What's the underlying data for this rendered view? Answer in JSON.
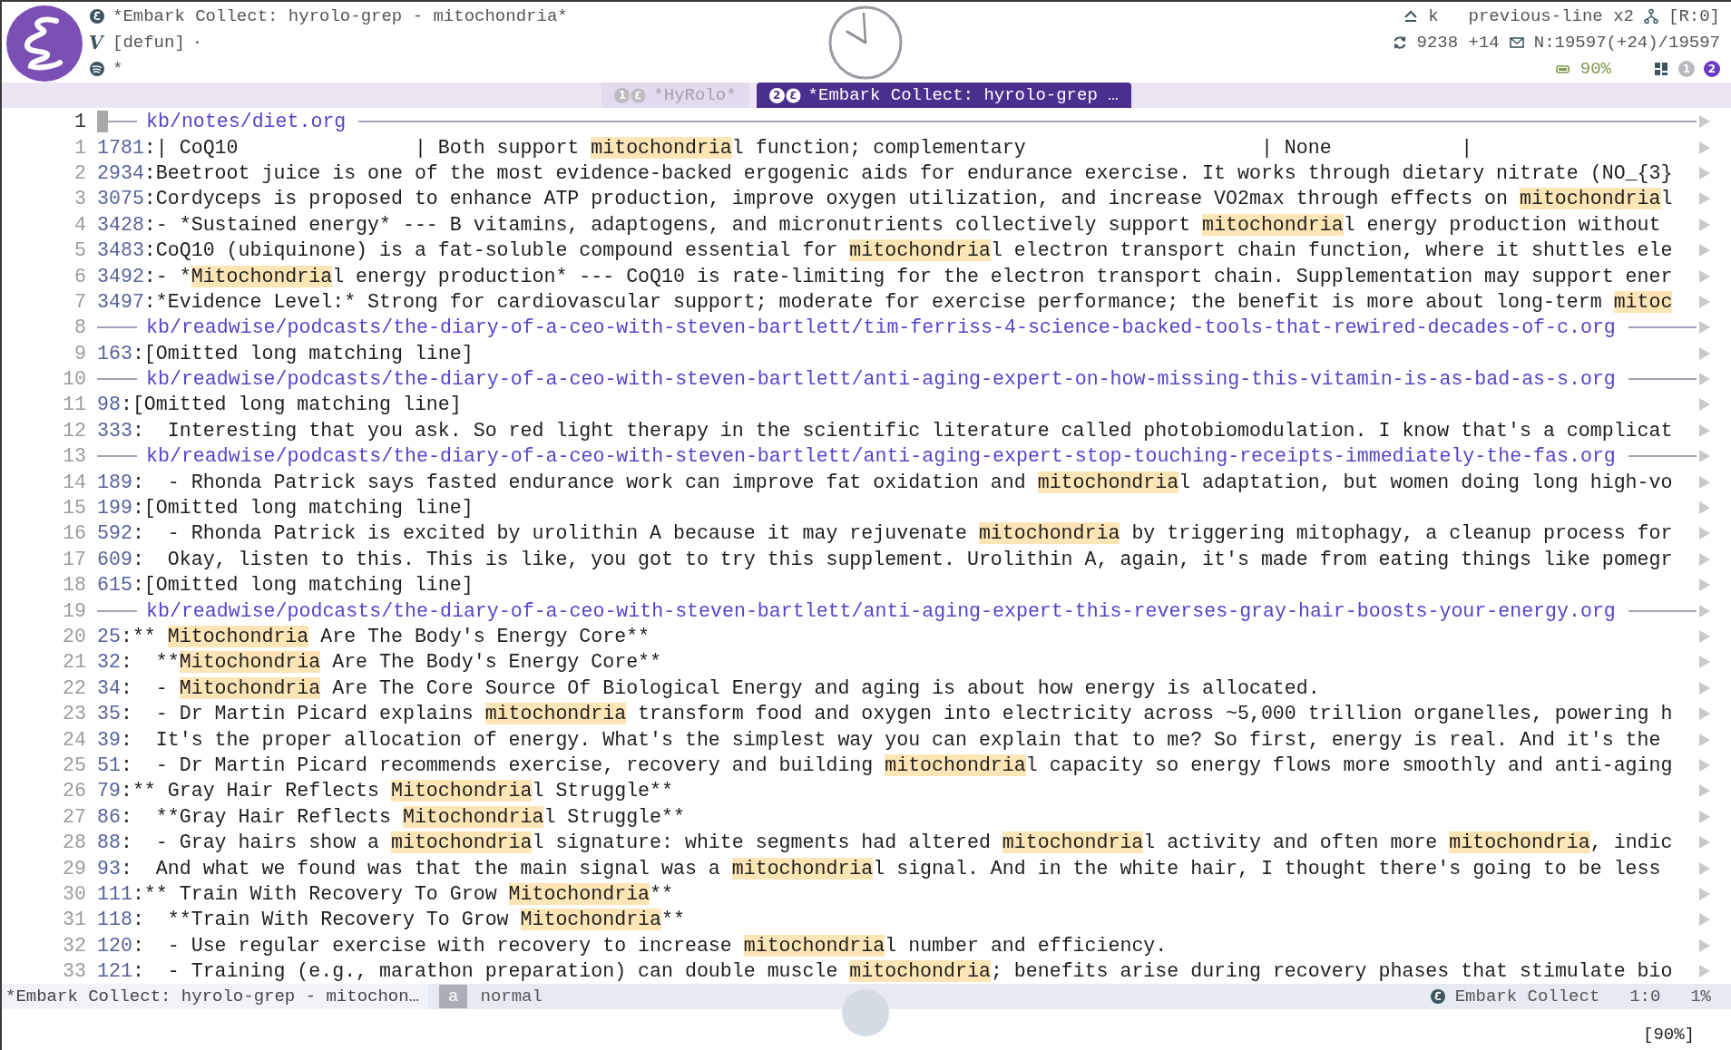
{
  "header": {
    "title": "*Embark Collect: hyrolo-grep - mitochondria*",
    "mode_glyph": "V",
    "function": "[defun]",
    "dot": "·",
    "marker": "*",
    "key": "k",
    "command": "previous-line x2",
    "register": "[R:0]",
    "sync": "9238 +14",
    "mail": "N:19597(+24)/19597",
    "battery": "90%",
    "workspaces": [
      {
        "label": "1",
        "selected": false
      },
      {
        "label": "2",
        "selected": true
      }
    ]
  },
  "tabs": [
    {
      "number": "1",
      "label": "*HyRolo*",
      "selected": false
    },
    {
      "number": "2",
      "label": "*Embark Collect: hyrolo-grep …",
      "selected": true
    }
  ],
  "rows": [
    {
      "line_number": "1",
      "kind": "file",
      "cursor": true,
      "path": "kb/notes/diet.org"
    },
    {
      "line_number": "1",
      "kind": "match",
      "cursor": false,
      "ref": "1781",
      "segments": [
        {
          "text": ":| CoQ10               | Both support ",
          "highlight": false
        },
        {
          "text": "mitochondria",
          "highlight": true
        },
        {
          "text": "l function; complementary                    | None           |",
          "highlight": false
        }
      ]
    },
    {
      "line_number": "2",
      "kind": "match",
      "cursor": false,
      "ref": "2934",
      "segments": [
        {
          "text": ":Beetroot juice is one of the most evidence-backed ergogenic aids for endurance exercise. It works through dietary nitrate (NO_{3}",
          "highlight": false
        }
      ]
    },
    {
      "line_number": "3",
      "kind": "match",
      "cursor": false,
      "ref": "3075",
      "segments": [
        {
          "text": ":Cordyceps is proposed to enhance ATP production, improve oxygen utilization, and increase VO2max through effects on ",
          "highlight": false
        },
        {
          "text": "mitochondria",
          "highlight": true
        },
        {
          "text": "l",
          "highlight": false
        }
      ]
    },
    {
      "line_number": "4",
      "kind": "match",
      "cursor": false,
      "ref": "3428",
      "segments": [
        {
          "text": ":- *Sustained energy* --- B vitamins, adaptogens, and micronutrients collectively support ",
          "highlight": false
        },
        {
          "text": "mitochondria",
          "highlight": true
        },
        {
          "text": "l energy production without",
          "highlight": false
        }
      ]
    },
    {
      "line_number": "5",
      "kind": "match",
      "cursor": false,
      "ref": "3483",
      "segments": [
        {
          "text": ":CoQ10 (ubiquinone) is a fat-soluble compound essential for ",
          "highlight": false
        },
        {
          "text": "mitochondria",
          "highlight": true
        },
        {
          "text": "l electron transport chain function, where it shuttles ele",
          "highlight": false
        }
      ]
    },
    {
      "line_number": "6",
      "kind": "match",
      "cursor": false,
      "ref": "3492",
      "segments": [
        {
          "text": ":- *",
          "highlight": false
        },
        {
          "text": "Mitochondria",
          "highlight": true
        },
        {
          "text": "l energy production* --- CoQ10 is rate-limiting for the electron transport chain. Supplementation may support ener",
          "highlight": false
        }
      ]
    },
    {
      "line_number": "7",
      "kind": "match",
      "cursor": false,
      "ref": "3497",
      "segments": [
        {
          "text": ":*Evidence Level:* Strong for cardiovascular support; moderate for exercise performance; the benefit is more about long-term ",
          "highlight": false
        },
        {
          "text": "mitoc",
          "highlight": true
        }
      ]
    },
    {
      "line_number": "8",
      "kind": "file",
      "cursor": false,
      "path": "kb/readwise/podcasts/the-diary-of-a-ceo-with-steven-bartlett/tim-ferriss-4-science-backed-tools-that-rewired-decades-of-c.org"
    },
    {
      "line_number": "9",
      "kind": "match",
      "cursor": false,
      "ref": "163",
      "segments": [
        {
          "text": ":[Omitted long matching line]",
          "highlight": false
        }
      ]
    },
    {
      "line_number": "10",
      "kind": "file",
      "cursor": false,
      "path": "kb/readwise/podcasts/the-diary-of-a-ceo-with-steven-bartlett/anti-aging-expert-on-how-missing-this-vitamin-is-as-bad-as-s.org"
    },
    {
      "line_number": "11",
      "kind": "match",
      "cursor": false,
      "ref": "98",
      "segments": [
        {
          "text": ":[Omitted long matching line]",
          "highlight": false
        }
      ]
    },
    {
      "line_number": "12",
      "kind": "match",
      "cursor": false,
      "ref": "333",
      "segments": [
        {
          "text": ":  Interesting that you ask. So red light therapy in the scientific literature called photobiomodulation. I know that's a complicat",
          "highlight": false
        }
      ]
    },
    {
      "line_number": "13",
      "kind": "file",
      "cursor": false,
      "path": "kb/readwise/podcasts/the-diary-of-a-ceo-with-steven-bartlett/anti-aging-expert-stop-touching-receipts-immediately-the-fas.org"
    },
    {
      "line_number": "14",
      "kind": "match",
      "cursor": false,
      "ref": "189",
      "segments": [
        {
          "text": ":  - Rhonda Patrick says fasted endurance work can improve fat oxidation and ",
          "highlight": false
        },
        {
          "text": "mitochondria",
          "highlight": true
        },
        {
          "text": "l adaptation, but women doing long high-vo",
          "highlight": false
        }
      ]
    },
    {
      "line_number": "15",
      "kind": "match",
      "cursor": false,
      "ref": "199",
      "segments": [
        {
          "text": ":[Omitted long matching line]",
          "highlight": false
        }
      ]
    },
    {
      "line_number": "16",
      "kind": "match",
      "cursor": false,
      "ref": "592",
      "segments": [
        {
          "text": ":  - Rhonda Patrick is excited by urolithin A because it may rejuvenate ",
          "highlight": false
        },
        {
          "text": "mitochondria",
          "highlight": true
        },
        {
          "text": " by triggering mitophagy, a cleanup process for",
          "highlight": false
        }
      ]
    },
    {
      "line_number": "17",
      "kind": "match",
      "cursor": false,
      "ref": "609",
      "segments": [
        {
          "text": ":  Okay, listen to this. This is like, you got to try this supplement. Urolithin A, again, it's made from eating things like pomegr",
          "highlight": false
        }
      ]
    },
    {
      "line_number": "18",
      "kind": "match",
      "cursor": false,
      "ref": "615",
      "segments": [
        {
          "text": ":[Omitted long matching line]",
          "highlight": false
        }
      ]
    },
    {
      "line_number": "19",
      "kind": "file",
      "cursor": false,
      "path": "kb/readwise/podcasts/the-diary-of-a-ceo-with-steven-bartlett/anti-aging-expert-this-reverses-gray-hair-boosts-your-energy.org"
    },
    {
      "line_number": "20",
      "kind": "match",
      "cursor": false,
      "ref": "25",
      "segments": [
        {
          "text": ":** ",
          "highlight": false
        },
        {
          "text": "Mitochondria",
          "highlight": true
        },
        {
          "text": " Are The Body's Energy Core**",
          "highlight": false
        }
      ]
    },
    {
      "line_number": "21",
      "kind": "match",
      "cursor": false,
      "ref": "32",
      "segments": [
        {
          "text": ":  **",
          "highlight": false
        },
        {
          "text": "Mitochondria",
          "highlight": true
        },
        {
          "text": " Are The Body's Energy Core**",
          "highlight": false
        }
      ]
    },
    {
      "line_number": "22",
      "kind": "match",
      "cursor": false,
      "ref": "34",
      "segments": [
        {
          "text": ":  - ",
          "highlight": false
        },
        {
          "text": "Mitochondria",
          "highlight": true
        },
        {
          "text": " Are The Core Source Of Biological Energy and aging is about how energy is allocated.",
          "highlight": false
        }
      ]
    },
    {
      "line_number": "23",
      "kind": "match",
      "cursor": false,
      "ref": "35",
      "segments": [
        {
          "text": ":  - Dr Martin Picard explains ",
          "highlight": false
        },
        {
          "text": "mitochondria",
          "highlight": true
        },
        {
          "text": " transform food and oxygen into electricity across ~5,000 trillion organelles, powering h",
          "highlight": false
        }
      ]
    },
    {
      "line_number": "24",
      "kind": "match",
      "cursor": false,
      "ref": "39",
      "segments": [
        {
          "text": ":  It's the proper allocation of energy. What's the simplest way you can explain that to me? So first, energy is real. And it's the",
          "highlight": false
        }
      ]
    },
    {
      "line_number": "25",
      "kind": "match",
      "cursor": false,
      "ref": "51",
      "segments": [
        {
          "text": ":  - Dr Martin Picard recommends exercise, recovery and building ",
          "highlight": false
        },
        {
          "text": "mitochondria",
          "highlight": true
        },
        {
          "text": "l capacity so energy flows more smoothly and anti-aging",
          "highlight": false
        }
      ]
    },
    {
      "line_number": "26",
      "kind": "match",
      "cursor": false,
      "ref": "79",
      "segments": [
        {
          "text": ":** Gray Hair Reflects ",
          "highlight": false
        },
        {
          "text": "Mitochondria",
          "highlight": true
        },
        {
          "text": "l Struggle**",
          "highlight": false
        }
      ]
    },
    {
      "line_number": "27",
      "kind": "match",
      "cursor": false,
      "ref": "86",
      "segments": [
        {
          "text": ":  **Gray Hair Reflects ",
          "highlight": false
        },
        {
          "text": "Mitochondria",
          "highlight": true
        },
        {
          "text": "l Struggle**",
          "highlight": false
        }
      ]
    },
    {
      "line_number": "28",
      "kind": "match",
      "cursor": false,
      "ref": "88",
      "segments": [
        {
          "text": ":  - Gray hairs show a ",
          "highlight": false
        },
        {
          "text": "mitochondria",
          "highlight": true
        },
        {
          "text": "l signature: white segments had altered ",
          "highlight": false
        },
        {
          "text": "mitochondria",
          "highlight": true
        },
        {
          "text": "l activity and often more ",
          "highlight": false
        },
        {
          "text": "mitochondria",
          "highlight": true
        },
        {
          "text": ", indic",
          "highlight": false
        }
      ]
    },
    {
      "line_number": "29",
      "kind": "match",
      "cursor": false,
      "ref": "93",
      "segments": [
        {
          "text": ":  And what we found was that the main signal was a ",
          "highlight": false
        },
        {
          "text": "mitochondria",
          "highlight": true
        },
        {
          "text": "l signal. And in the white hair, I thought there's going to be less",
          "highlight": false
        }
      ]
    },
    {
      "line_number": "30",
      "kind": "match",
      "cursor": false,
      "ref": "111",
      "segments": [
        {
          "text": ":** Train With Recovery To Grow ",
          "highlight": false
        },
        {
          "text": "Mitochondria",
          "highlight": true
        },
        {
          "text": "**",
          "highlight": false
        }
      ]
    },
    {
      "line_number": "31",
      "kind": "match",
      "cursor": false,
      "ref": "118",
      "segments": [
        {
          "text": ":  **Train With Recovery To Grow ",
          "highlight": false
        },
        {
          "text": "Mitochondria",
          "highlight": true
        },
        {
          "text": "**",
          "highlight": false
        }
      ]
    },
    {
      "line_number": "32",
      "kind": "match",
      "cursor": false,
      "ref": "120",
      "segments": [
        {
          "text": ":  - Use regular exercise with recovery to increase ",
          "highlight": false
        },
        {
          "text": "mitochondria",
          "highlight": true
        },
        {
          "text": "l number and efficiency.",
          "highlight": false
        }
      ]
    },
    {
      "line_number": "33",
      "kind": "match",
      "cursor": false,
      "ref": "121",
      "segments": [
        {
          "text": ":  - Training (e.g., marathon preparation) can double muscle ",
          "highlight": false
        },
        {
          "text": "mitochondria",
          "highlight": true
        },
        {
          "text": "; benefits arise during recovery phases that stimulate bio",
          "highlight": false
        }
      ]
    }
  ],
  "mode_line": {
    "buffer": "*Embark Collect: hyrolo-grep - mitochon…",
    "state_key": "a",
    "state": "normal",
    "mode": "Embark Collect",
    "position": "1:0",
    "percent": "1%"
  },
  "echo": "[90%]"
}
